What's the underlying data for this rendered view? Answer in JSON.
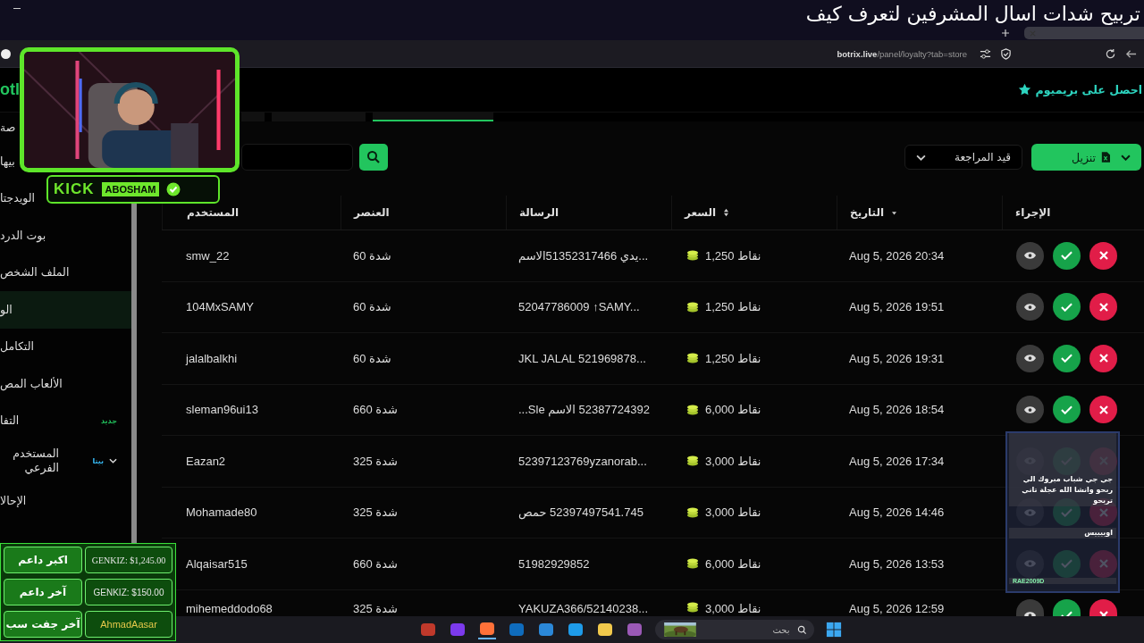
{
  "caption": "تربيح شدات اسال المشرفين لتعرف كيف",
  "browser": {
    "url_host": "botrix.live",
    "url_path": "/panel/loyalty?tab=store"
  },
  "header": {
    "logo": "otl",
    "premium": "احصل على بريميوم"
  },
  "sidebar": {
    "items": [
      {
        "label": "صة",
        "kind": "link",
        "selected": false
      },
      {
        "label": "بيها",
        "kind": "link",
        "selected": false
      },
      {
        "label": "الويدجتا",
        "kind": "link",
        "selected": false
      },
      {
        "label": "بوت الدرد",
        "kind": "link",
        "selected": false
      },
      {
        "label": "الملف الشخص",
        "kind": "link",
        "selected": false
      },
      {
        "label": "الو",
        "kind": "link",
        "selected": true
      },
      {
        "label": "التكامل",
        "kind": "link",
        "selected": false
      },
      {
        "label": "الألعاب المص",
        "kind": "link",
        "selected": false
      },
      {
        "label": "التفا",
        "kind": "link",
        "selected": false,
        "badge": "جديد",
        "color": "#22c55e"
      },
      {
        "label": "المستخدم الفرعي",
        "kind": "group",
        "selected": false,
        "badge": "بيتا",
        "color": "#38bdf8"
      },
      {
        "label": "الإحالا",
        "kind": "link",
        "selected": false
      }
    ]
  },
  "tabs": [
    {
      "selected": false
    },
    {
      "selected": false
    },
    {
      "selected": true
    }
  ],
  "toolbar": {
    "filter": "قيد المراجعة",
    "download": "تنزيل"
  },
  "table": {
    "columns": [
      {
        "label": "الإجراء",
        "sortable": false,
        "sorted": false
      },
      {
        "label": "التاريخ",
        "sortable": true,
        "sorted": true
      },
      {
        "label": "السعر",
        "sortable": true,
        "sorted": false
      },
      {
        "label": "الرسالة",
        "sortable": false,
        "sorted": false
      },
      {
        "label": "العنصر",
        "sortable": false,
        "sorted": false
      },
      {
        "label": "المستخدم",
        "sortable": false,
        "sorted": false
      }
    ],
    "rows": [
      {
        "user": "smw_22",
        "item": "شدة 60",
        "message": "...يدي 51352317466الاسم",
        "price": "1,250 نقاط",
        "date": "Aug 5, 2026 20:34"
      },
      {
        "user": "104MxSAMY",
        "item": "شدة 60",
        "message": "52047786009 ↑SAMY...",
        "price": "1,250 نقاط",
        "date": "Aug 5, 2026 19:51"
      },
      {
        "user": "jalalbalkhi",
        "item": "شدة 60",
        "message": "JKL JALAL 521969878...",
        "price": "1,250 نقاط",
        "date": "Aug 5, 2026 19:31"
      },
      {
        "user": "sleman96ui13",
        "item": "شدة 660",
        "message": "52387724392 الاسم Sle...",
        "price": "6,000 نقاط",
        "date": "Aug 5, 2026 18:54"
      },
      {
        "user": "Eazan2",
        "item": "شدة 325",
        "message": "52397123769yzanorab...",
        "price": "3,000 نقاط",
        "date": "Aug 5, 2026 17:34"
      },
      {
        "user": "Mohamade80",
        "item": "شدة 325",
        "message": "52397497541.745 حمص",
        "price": "3,000 نقاط",
        "date": "Aug 5, 2026 14:46"
      },
      {
        "user": "Alqaisar515",
        "item": "شدة 660",
        "message": "51982929852",
        "price": "6,000 نقاط",
        "date": "Aug 5, 2026 13:53"
      },
      {
        "user": "mihemeddodo68",
        "item": "شدة 325",
        "message": "YAKUZA366/52140238...",
        "price": "3,000 نقاط",
        "date": "Aug 5, 2026 12:59"
      }
    ]
  },
  "webcam": {
    "platform": "KICK",
    "channel": "ABOSHAM"
  },
  "chat": [
    {
      "text": "جي جي شباب مبروك الي ربحو وانشا الله عجلة تاني تربحو"
    },
    {
      "text": "اوييييس"
    },
    {
      "name": "RAE2009D",
      "color": "#86efac"
    }
  ],
  "stats": [
    {
      "label": "اكبر داعم",
      "value": "GENKIZ: $1,245.00"
    },
    {
      "label": "آخر داعم",
      "value": "GENKIZ: $150.00"
    },
    {
      "label": "آخر جفت سب",
      "value": "AhmadAasar"
    }
  ],
  "taskbar": {
    "search": {
      "placeholder": "بحث"
    }
  }
}
